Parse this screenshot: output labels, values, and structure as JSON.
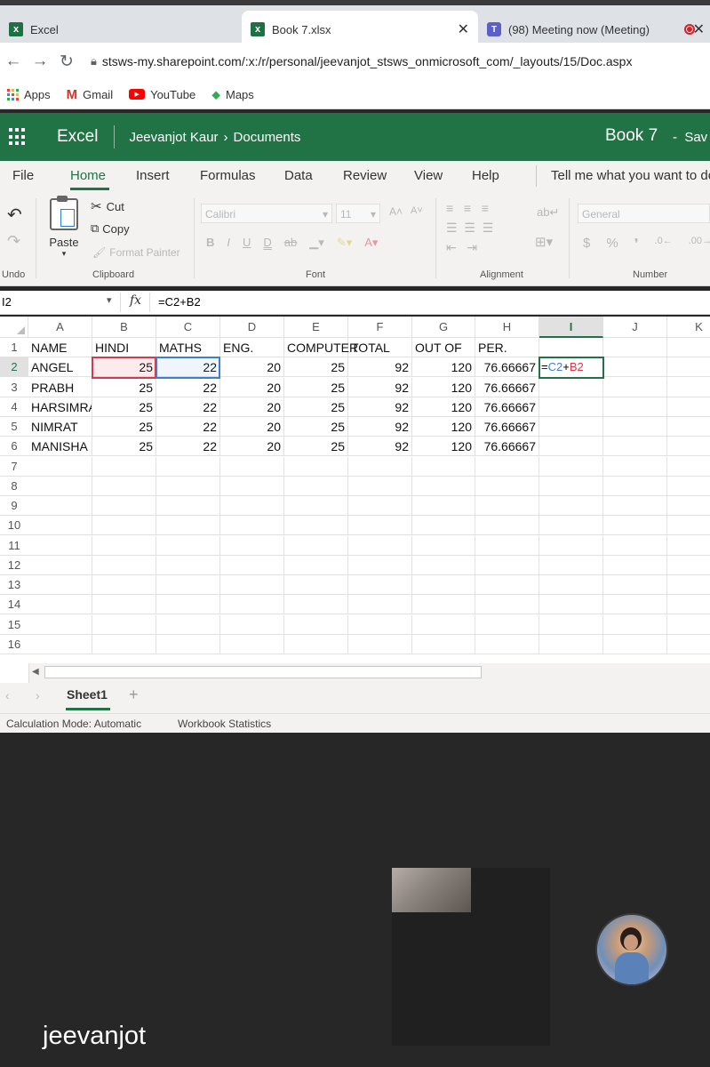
{
  "browser": {
    "tabs": [
      {
        "title": "Excel",
        "icon": "excel-icon"
      },
      {
        "title": "Book 7.xlsx",
        "icon": "excel-icon",
        "close": "✕"
      },
      {
        "title": "(98) Meeting now (Meeting)",
        "icon": "teams-icon"
      }
    ],
    "url": "stsws-my.sharepoint.com/:x:/r/personal/jeevanjot_stsws_onmicrosoft_com/_layouts/15/Doc.aspx",
    "bookmarks": [
      {
        "label": "Apps",
        "icon": "apps-grid-icon"
      },
      {
        "label": "Gmail",
        "icon": "gmail-icon"
      },
      {
        "label": "YouTube",
        "icon": "youtube-icon"
      },
      {
        "label": "Maps",
        "icon": "maps-icon"
      }
    ]
  },
  "excel": {
    "app_name": "Excel",
    "breadcrumb_user": "Jeevanjot Kaur",
    "breadcrumb_sep": "›",
    "breadcrumb_folder": "Documents",
    "doc_title": "Book 7",
    "doc_status": "-  Sav",
    "ribbon_tabs": [
      "File",
      "Home",
      "Insert",
      "Formulas",
      "Data",
      "Review",
      "View",
      "Help"
    ],
    "tell_me": "Tell me what you want to do",
    "clipboard": {
      "paste": "Paste",
      "cut": "Cut",
      "copy": "Copy",
      "format_painter": "Format Painter"
    },
    "font": {
      "name": "Calibri",
      "size": "11"
    },
    "number_format": "General",
    "group_labels": {
      "undo": "Undo",
      "clipboard": "Clipboard",
      "font": "Font",
      "alignment": "Alignment",
      "number": "Number"
    },
    "name_box": "I2",
    "formula": "=C2+B2",
    "columns": [
      "A",
      "B",
      "C",
      "D",
      "E",
      "F",
      "G",
      "H",
      "I",
      "J",
      "K"
    ],
    "rows": [
      "1",
      "2",
      "3",
      "4",
      "5",
      "6",
      "7",
      "8",
      "9",
      "10",
      "11",
      "12",
      "13",
      "14",
      "15",
      "16"
    ],
    "header_row": [
      "NAME",
      "HINDI",
      "MATHS",
      "ENG.",
      "COMPUTER",
      "TOTAL",
      "OUT OF",
      "PER."
    ],
    "data_rows": [
      [
        "ANGEL",
        "25",
        "22",
        "20",
        "25",
        "92",
        "120",
        "76.66667"
      ],
      [
        "PRABH",
        "25",
        "22",
        "20",
        "25",
        "92",
        "120",
        "76.66667"
      ],
      [
        "HARSIMRAN",
        "25",
        "22",
        "20",
        "25",
        "92",
        "120",
        "76.66667"
      ],
      [
        "NIMRAT",
        "25",
        "22",
        "20",
        "25",
        "92",
        "120",
        "76.66667"
      ],
      [
        "MANISHA",
        "25",
        "22",
        "20",
        "25",
        "92",
        "120",
        "76.66667"
      ]
    ],
    "editing_cell": {
      "eq": "=",
      "ref1": "C2",
      "op": "+",
      "ref2": "B2"
    },
    "sheet_tab": "Sheet1",
    "add_sheet": "+",
    "status_calc": "Calculation Mode: Automatic",
    "status_stats": "Workbook Statistics"
  },
  "meeting": {
    "participant_name": "jeevanjot"
  },
  "colors": {
    "excel_green": "#217346",
    "ref_red": "#d6384c",
    "ref_blue": "#3c7fd1"
  }
}
